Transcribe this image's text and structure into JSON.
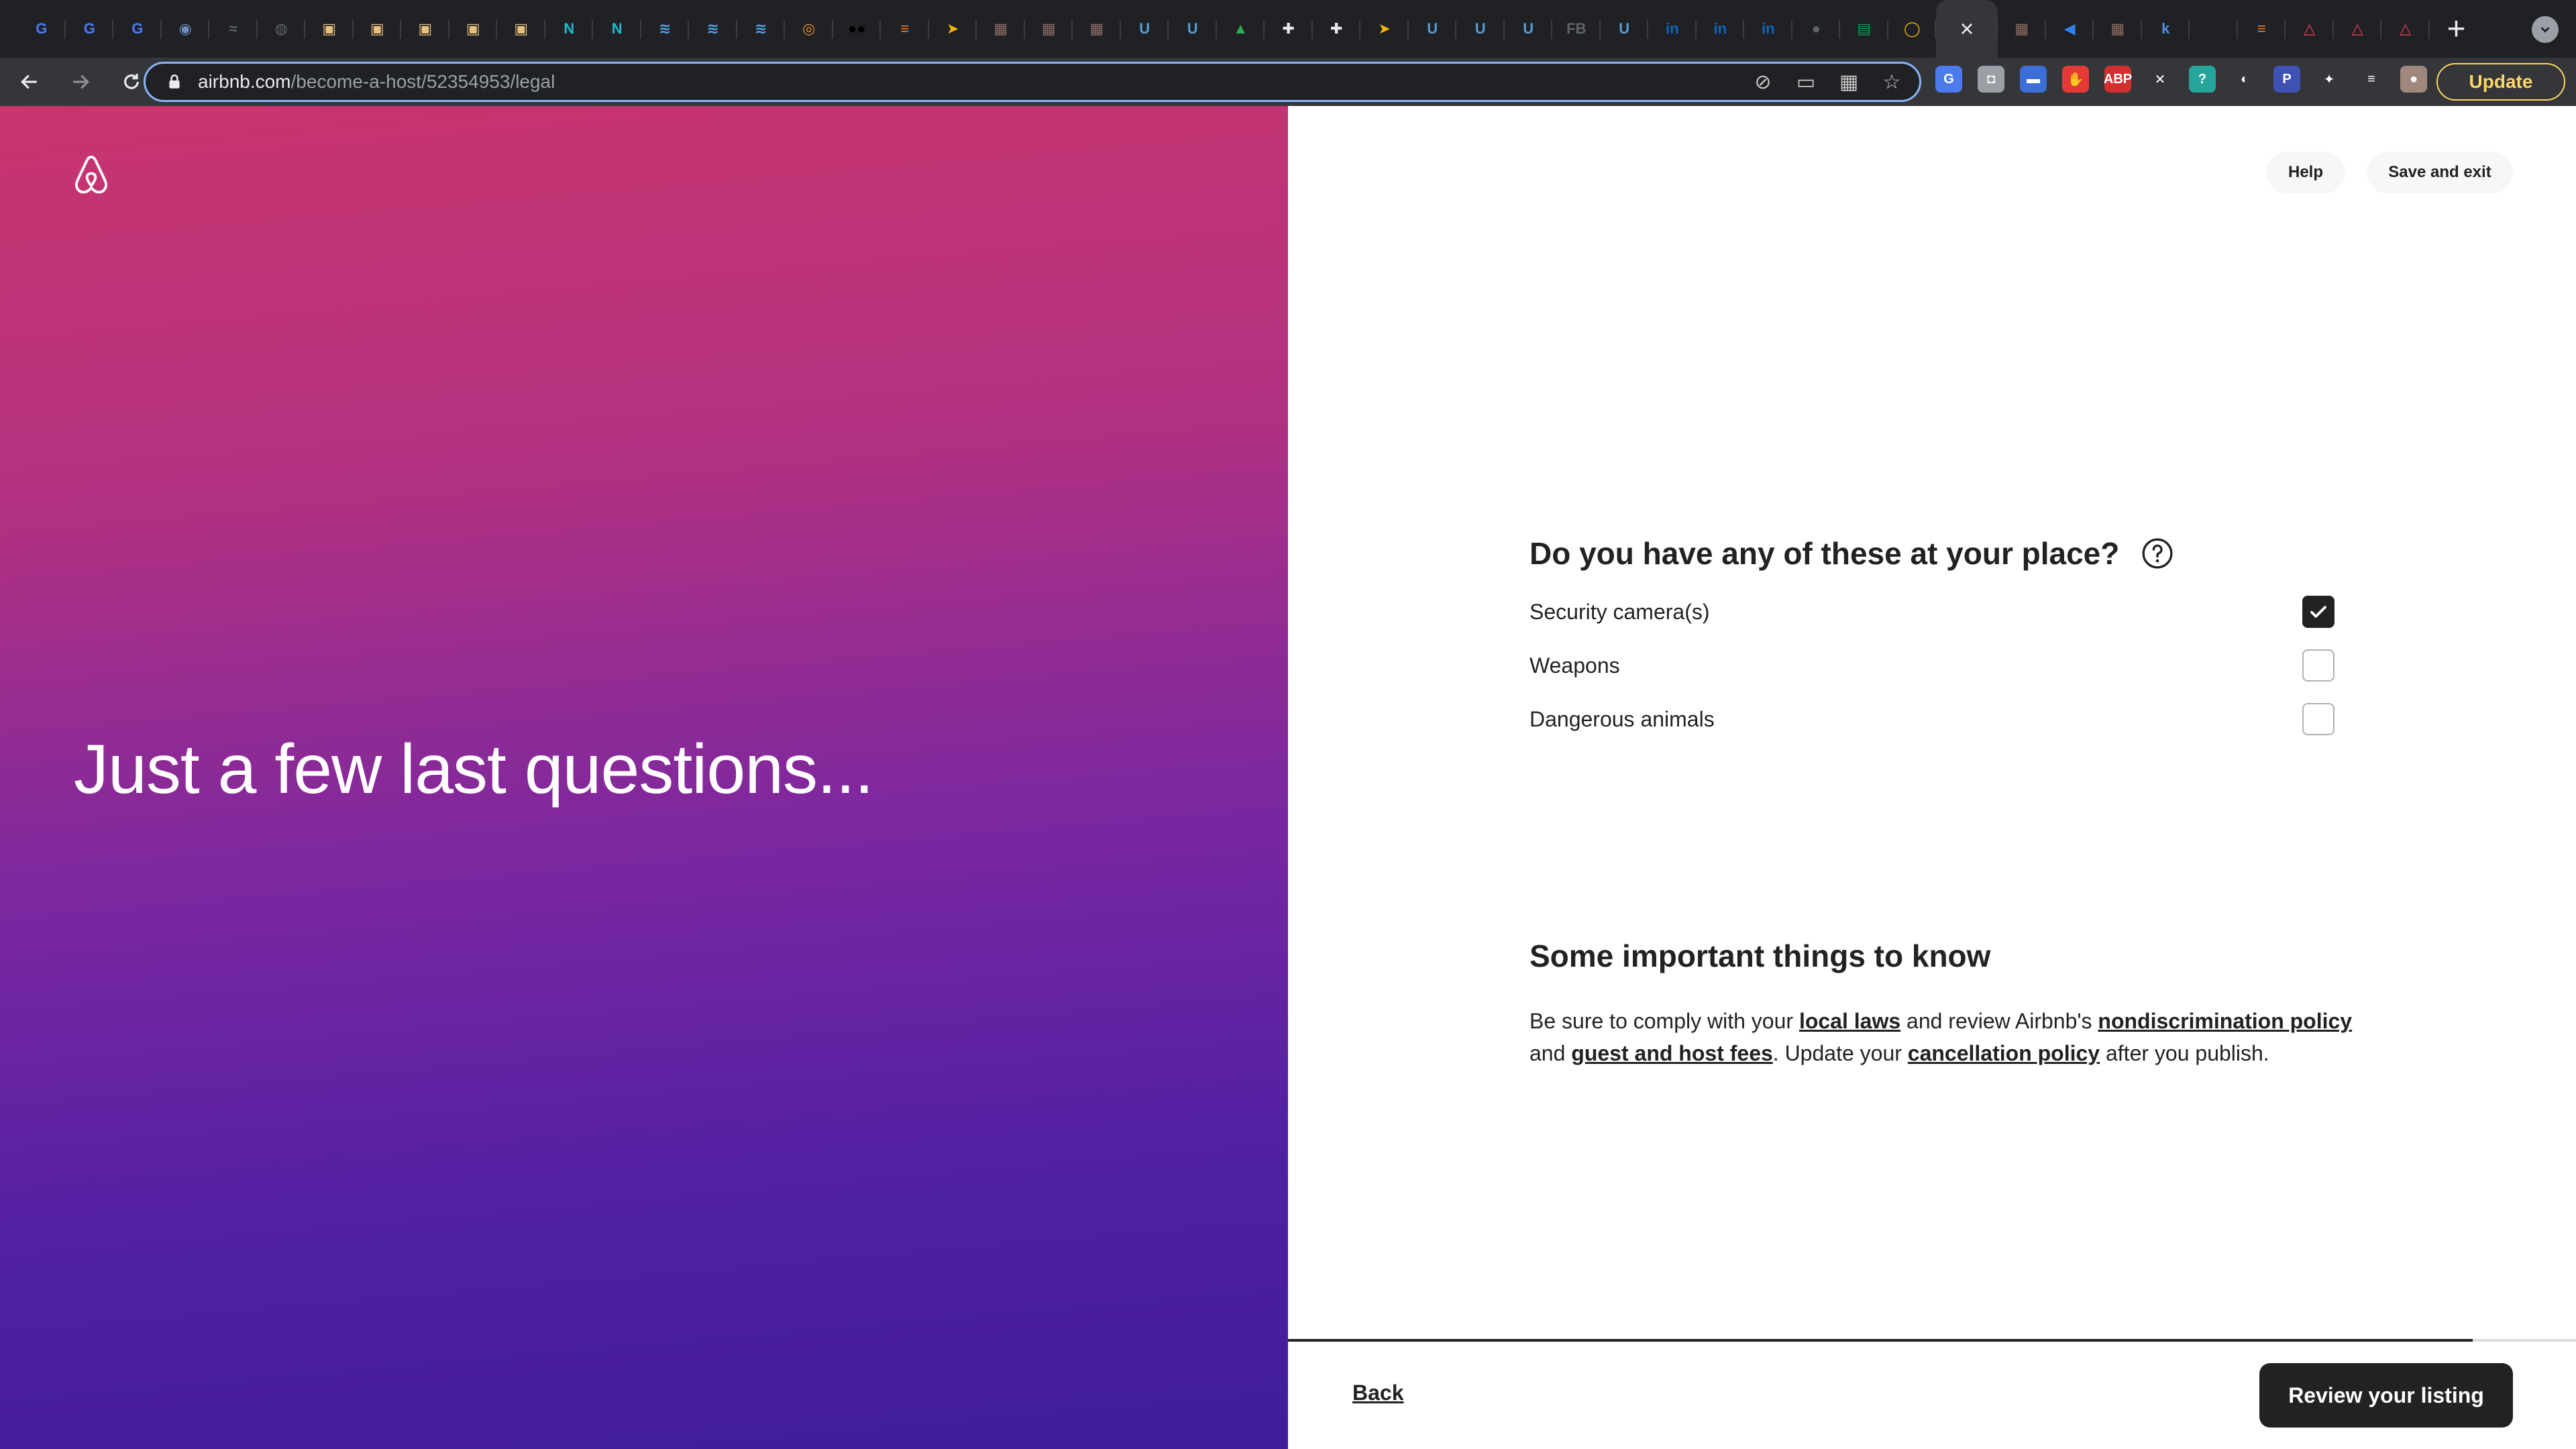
{
  "browser": {
    "tabs": [
      {
        "icon": "translate-icon",
        "color": "#4b7bec",
        "glyph": "G"
      },
      {
        "icon": "translate-icon",
        "color": "#4b7bec",
        "glyph": "G"
      },
      {
        "icon": "translate-icon",
        "color": "#4b7bec",
        "glyph": "G"
      },
      {
        "icon": "app-icon",
        "color": "#6c8ebf",
        "glyph": "◉"
      },
      {
        "icon": "chart-icon",
        "color": "#5f6368",
        "glyph": "≈"
      },
      {
        "icon": "globe-icon",
        "color": "#5f6368",
        "glyph": "◍"
      },
      {
        "icon": "site-icon",
        "color": "#e8c07d",
        "glyph": "▣"
      },
      {
        "icon": "site-icon",
        "color": "#e8c07d",
        "glyph": "▣"
      },
      {
        "icon": "site-icon",
        "color": "#e8c07d",
        "glyph": "▣"
      },
      {
        "icon": "site-icon",
        "color": "#e8c07d",
        "glyph": "▣"
      },
      {
        "icon": "site-icon",
        "color": "#e8c07d",
        "glyph": "▣"
      },
      {
        "icon": "n-icon",
        "color": "#29b6d1",
        "glyph": "N"
      },
      {
        "icon": "n-icon",
        "color": "#29b6d1",
        "glyph": "N"
      },
      {
        "icon": "bird-icon",
        "color": "#4fa3e0",
        "glyph": "≋"
      },
      {
        "icon": "bird-icon",
        "color": "#4fa3e0",
        "glyph": "≋"
      },
      {
        "icon": "bird-icon",
        "color": "#4fa3e0",
        "glyph": "≋"
      },
      {
        "icon": "search-icon",
        "color": "#e58e26",
        "glyph": "◎"
      },
      {
        "icon": "medium-icon",
        "color": "#000000",
        "glyph": "●●"
      },
      {
        "icon": "stack-icon",
        "color": "#f48024",
        "glyph": "≡"
      },
      {
        "icon": "arrow-icon",
        "color": "#f5b400",
        "glyph": "➤"
      },
      {
        "icon": "site-icon",
        "color": "#8d6e63",
        "glyph": "▦"
      },
      {
        "icon": "site-icon",
        "color": "#8d6e63",
        "glyph": "▦"
      },
      {
        "icon": "site-icon",
        "color": "#8d6e63",
        "glyph": "▦"
      },
      {
        "icon": "u-icon",
        "color": "#5b9bd5",
        "glyph": "U"
      },
      {
        "icon": "u-icon",
        "color": "#5b9bd5",
        "glyph": "U"
      },
      {
        "icon": "drive-icon",
        "color": "#34a853",
        "glyph": "▲"
      },
      {
        "icon": "plus-icon",
        "color": "#e8eaed",
        "glyph": "✚"
      },
      {
        "icon": "plus-icon",
        "color": "#e8eaed",
        "glyph": "✚"
      },
      {
        "icon": "arrow-icon",
        "color": "#f5b400",
        "glyph": "➤"
      },
      {
        "icon": "u-icon",
        "color": "#5b9bd5",
        "glyph": "U"
      },
      {
        "icon": "u-icon",
        "color": "#5b9bd5",
        "glyph": "U"
      },
      {
        "icon": "u-icon",
        "color": "#5b9bd5",
        "glyph": "U"
      },
      {
        "icon": "fb-icon",
        "color": "#5f6368",
        "glyph": "FB"
      },
      {
        "icon": "u-icon",
        "color": "#5b9bd5",
        "glyph": "U"
      },
      {
        "icon": "linkedin-icon",
        "color": "#0a66c2",
        "glyph": "in"
      },
      {
        "icon": "linkedin-icon",
        "color": "#0a66c2",
        "glyph": "in"
      },
      {
        "icon": "linkedin-icon",
        "color": "#0a66c2",
        "glyph": "in"
      },
      {
        "icon": "apple-icon",
        "color": "#5f6368",
        "glyph": "●"
      },
      {
        "icon": "sheets-icon",
        "color": "#0f9d58",
        "glyph": "▤"
      },
      {
        "icon": "ring-icon",
        "color": "#f4b400",
        "glyph": "◯"
      }
    ],
    "tabs_after": [
      {
        "icon": "site-icon",
        "color": "#8d6e63",
        "glyph": "▦"
      },
      {
        "icon": "vscode-icon",
        "color": "#2f80ed",
        "glyph": "◀"
      },
      {
        "icon": "site-icon",
        "color": "#8d6e63",
        "glyph": "▦"
      },
      {
        "icon": "k-icon",
        "color": "#4a90e2",
        "glyph": "k"
      },
      {
        "icon": "github-icon",
        "color": "#202124",
        "glyph": "●"
      },
      {
        "icon": "stack-icon",
        "color": "#f48024",
        "glyph": "≡"
      },
      {
        "icon": "airbnb-icon",
        "color": "#ff385c",
        "glyph": "△"
      },
      {
        "icon": "airbnb-icon",
        "color": "#ff385c",
        "glyph": "△"
      },
      {
        "icon": "airbnb-icon",
        "color": "#ff385c",
        "glyph": "△"
      }
    ],
    "url_host": "airbnb.com",
    "url_path": "/become-a-host/52354953/legal",
    "extensions": [
      {
        "icon": "translate-icon",
        "color": "#4b7bec",
        "glyph": "G"
      },
      {
        "icon": "grey-ext-icon",
        "color": "#9aa0a6",
        "glyph": "◘"
      },
      {
        "icon": "blue-ext-icon",
        "color": "#3b6fd6",
        "glyph": "▬"
      },
      {
        "icon": "red-ext-icon",
        "color": "#e53935",
        "glyph": "✋"
      },
      {
        "icon": "abp-icon",
        "color": "#d32f2f",
        "glyph": "ABP"
      },
      {
        "icon": "x-ext-icon",
        "color": "#35363a",
        "glyph": "✕"
      },
      {
        "icon": "teal-ext-icon",
        "color": "#26a69a",
        "glyph": "?"
      },
      {
        "icon": "sketch-ext-icon",
        "color": "#35363a",
        "glyph": "◐"
      },
      {
        "icon": "p-ext-icon",
        "color": "#3f51b5",
        "glyph": "P"
      },
      {
        "icon": "puzzle-icon",
        "color": "#35363a",
        "glyph": "✦"
      },
      {
        "icon": "playlist-icon",
        "color": "#35363a",
        "glyph": "≡"
      },
      {
        "icon": "avatar-icon",
        "color": "#a1887f",
        "glyph": "●"
      }
    ],
    "update_label": "Update"
  },
  "hero": {
    "title": "Just a few last questions..."
  },
  "header": {
    "help_label": "Help",
    "save_exit_label": "Save and exit"
  },
  "question": {
    "title": "Do you have any of these at your place?",
    "options": [
      {
        "label": "Security camera(s)",
        "checked": true
      },
      {
        "label": "Weapons",
        "checked": false
      },
      {
        "label": "Dangerous animals",
        "checked": false
      }
    ]
  },
  "notice": {
    "title": "Some important things to know",
    "p1": "Be sure to comply with your ",
    "link1": "local laws",
    "p2": " and review Airbnb's ",
    "link2": "nondiscrimination policy",
    "p3": " and ",
    "link3": "guest and host fees",
    "p4": ". Update your ",
    "link4": "cancellation policy",
    "p5": " after you publish."
  },
  "footer": {
    "back_label": "Back",
    "primary_label": "Review your listing",
    "progress_fraction": 0.92
  },
  "colors": {
    "accent": "#222222",
    "brand": "#ff385c"
  }
}
